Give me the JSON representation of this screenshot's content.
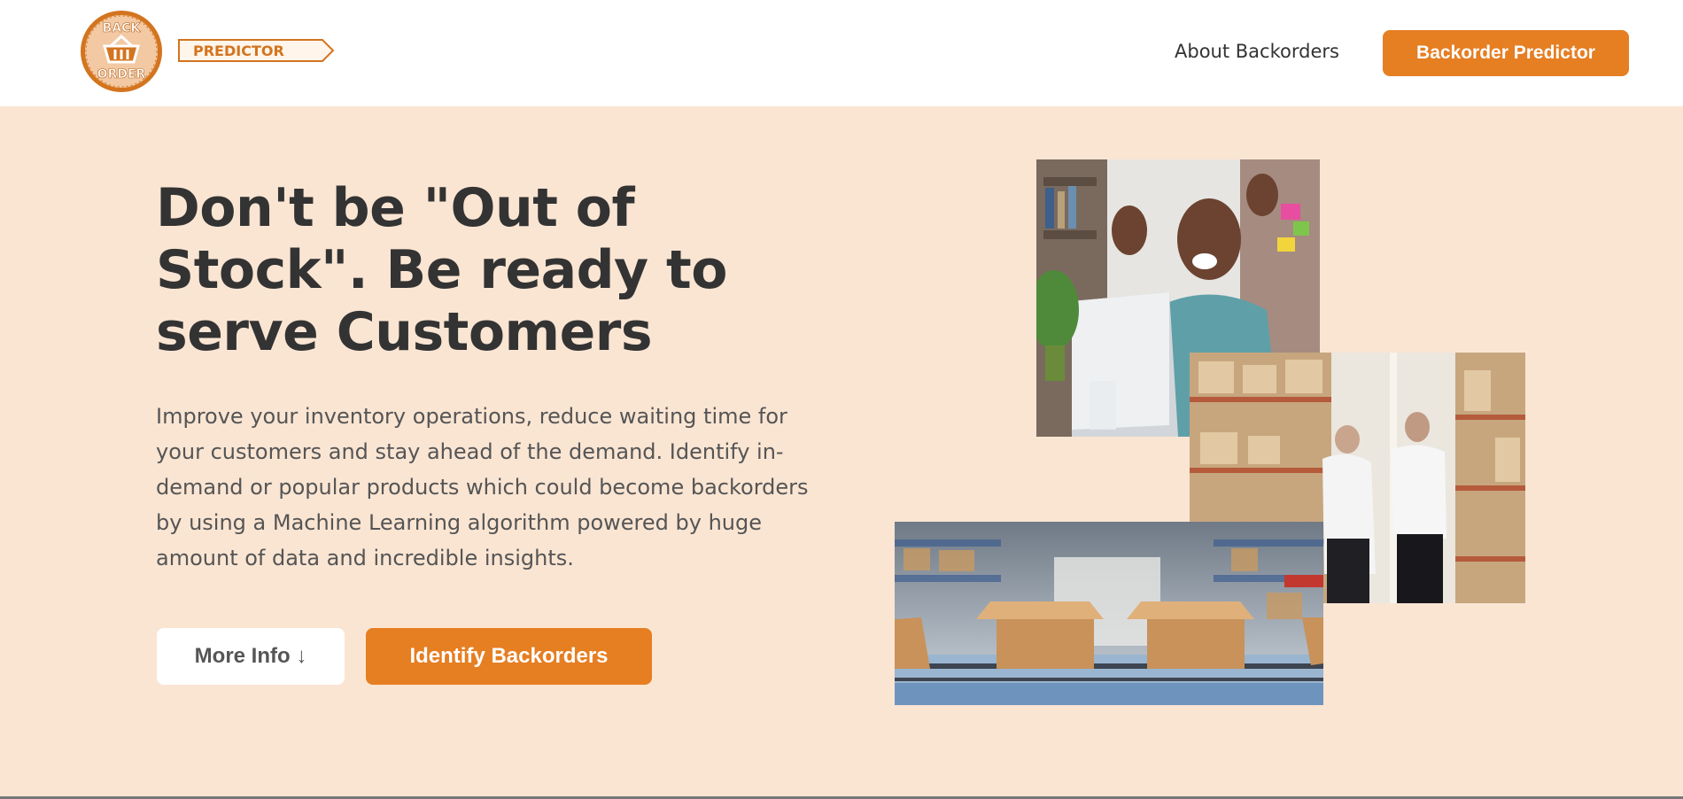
{
  "header": {
    "logo": {
      "top_text": "BACK",
      "bottom_text": "ORDER",
      "banner_text": "PREDICTOR",
      "brand_color": "#d3741f"
    },
    "nav_link": "About Backorders",
    "cta_label": "Backorder Predictor"
  },
  "hero": {
    "headline": "Don't be \"Out of Stock\". Be ready to serve Customers",
    "description": "Improve your inventory operations, reduce waiting time for your customers and stay ahead of the demand. Identify in-demand or popular products which could become backorders by using a Machine Learning algorithm powered by huge amount of data and incredible insights.",
    "more_info_label": "More Info ↓",
    "identify_label": "Identify Backorders",
    "images": [
      "excited-man-at-laptop-image",
      "warehouse-workers-image",
      "conveyor-boxes-image"
    ]
  },
  "colors": {
    "accent": "#e67e22",
    "hero_bg": "#fae5d3",
    "text_dark": "#333333",
    "text_body": "#555555"
  }
}
